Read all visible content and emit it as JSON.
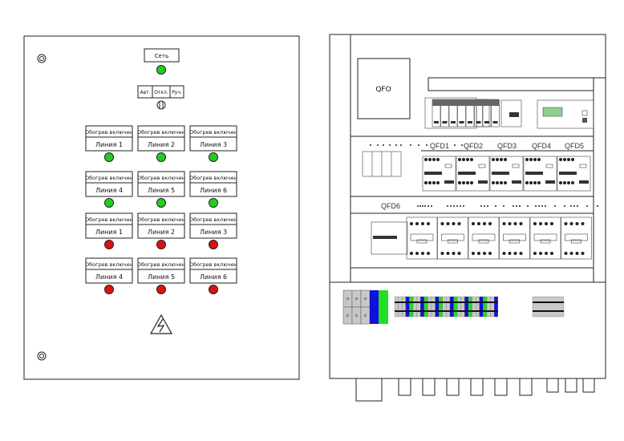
{
  "front_panel": {
    "network_label": "Сеть",
    "mode_switch": [
      "Авт.",
      "Откл.",
      "Руч."
    ],
    "indicators": [
      {
        "status": "Обогрев включен",
        "line": "Линия 1",
        "lamp": "green"
      },
      {
        "status": "Обогрев включен",
        "line": "Линия 2",
        "lamp": "green"
      },
      {
        "status": "Обогрев включен",
        "line": "Линия 3",
        "lamp": "green"
      },
      {
        "status": "Обогрев включен",
        "line": "Линия 4",
        "lamp": "green"
      },
      {
        "status": "Обогрев включен",
        "line": "Линия 5",
        "lamp": "green"
      },
      {
        "status": "Обогрев включен",
        "line": "Линия 6",
        "lamp": "green"
      },
      {
        "status": "Обогрев включен",
        "line": "Линия 1",
        "lamp": "red"
      },
      {
        "status": "Обогрев включен",
        "line": "Линия 2",
        "lamp": "red"
      },
      {
        "status": "Обогрев включен",
        "line": "Линия 3",
        "lamp": "red"
      },
      {
        "status": "Обогрев включен",
        "line": "Линия 4",
        "lamp": "red"
      },
      {
        "status": "Обогрев включен",
        "line": "Линия 5",
        "lamp": "red"
      },
      {
        "status": "Обогрев включен",
        "line": "Линия 6",
        "lamp": "red"
      }
    ]
  },
  "interior": {
    "main_breaker": "QFO",
    "breakers": [
      "QFD1",
      "QFD2",
      "QFD3",
      "QFD4",
      "QFD5"
    ],
    "breaker6": "QFD6"
  },
  "colors": {
    "green_lamp": "#22cc22",
    "red_lamp": "#dd1111",
    "terminal_blue": "#1010dd",
    "terminal_green": "#22dd22",
    "terminal_gray": "#c8c8c8"
  }
}
